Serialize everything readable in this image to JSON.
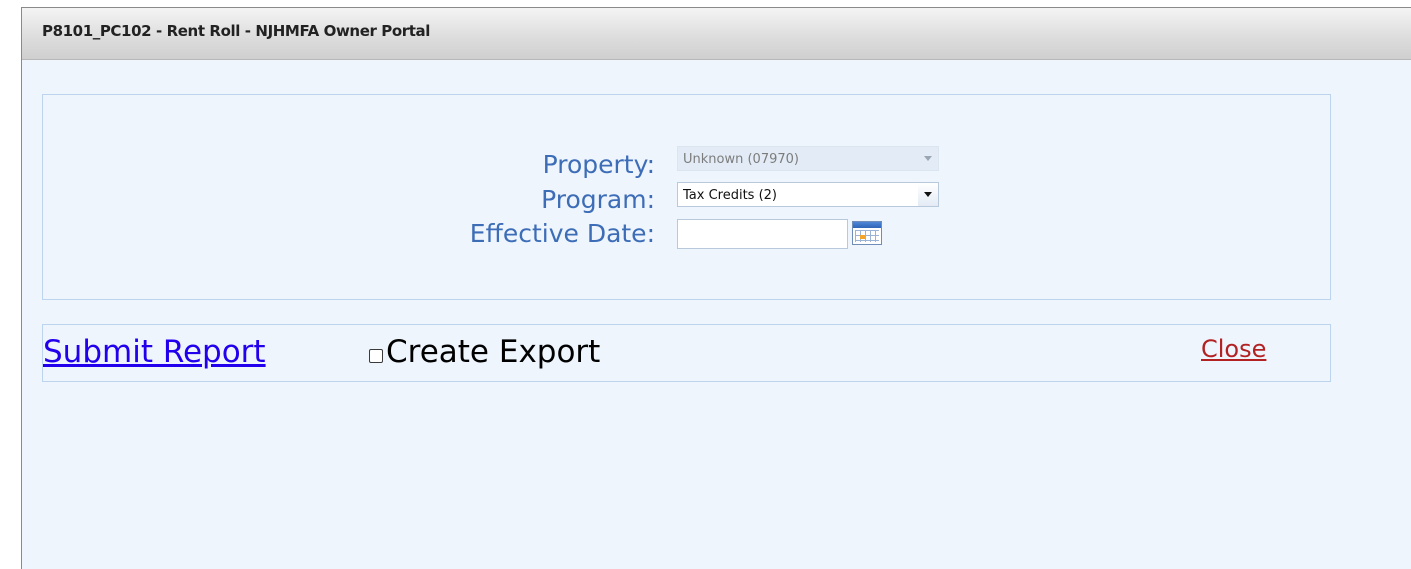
{
  "window": {
    "title": "P8101_PC102 - Rent Roll - NJHMFA Owner Portal"
  },
  "form": {
    "property": {
      "label": "Property:",
      "value": "Unknown (07970)",
      "disabled": true
    },
    "program": {
      "label": "Program:",
      "value": "Tax Credits (2)"
    },
    "effective_date": {
      "label": "Effective Date:",
      "value": "",
      "icon": "calendar-icon"
    }
  },
  "actions": {
    "submit_label": "Submit Report",
    "export_label": "Create Export",
    "export_checked": false,
    "close_label": "Close"
  },
  "colors": {
    "background": "#eef5fd",
    "label_blue": "#3d6db7",
    "link_blue": "#2200ee",
    "close_red": "#b22222"
  }
}
